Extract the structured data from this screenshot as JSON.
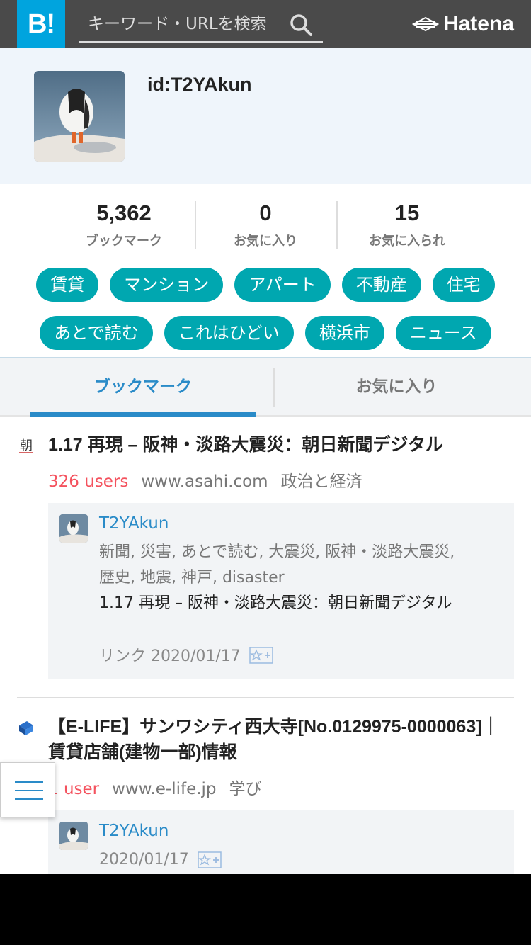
{
  "header": {
    "logo": "B!",
    "search_placeholder": "キーワード・URLを検索",
    "brand": "Hatena"
  },
  "profile": {
    "id": "id:T2YAkun"
  },
  "stats": [
    {
      "num": "5,362",
      "label": "ブックマーク"
    },
    {
      "num": "0",
      "label": "お気に入り"
    },
    {
      "num": "15",
      "label": "お気に入られ"
    }
  ],
  "tags_row1": [
    "賃貸",
    "マンション",
    "アパート",
    "不動産",
    "住宅"
  ],
  "tags_row2": [
    "あとで読む",
    "これはひどい",
    "横浜市",
    "ニュース"
  ],
  "tabs": {
    "bookmarks": "ブックマーク",
    "favorites": "お気に入り"
  },
  "entries": [
    {
      "title": "1.17 再現 – 阪神・淡路大震災：朝日新聞デジタル",
      "users": "326 users",
      "domain": "www.asahi.com",
      "category": "政治と経済",
      "user": "T2YAkun",
      "tags": "新聞, 災害, あとで読む, 大震災, 阪神・淡路大震災, 歴史, 地震, 神戸, disaster",
      "comment": "1.17 再現 – 阪神・淡路大震災：朝日新聞デジタル",
      "date": "リンク 2020/01/17"
    },
    {
      "title": "【E-LIFE】サンワシティ西大寺[No.0129975-0000063]｜賃貸店舗(建物一部)情報",
      "users": "1 user",
      "domain": "www.e-life.jp",
      "category": "学び",
      "user": "T2YAkun",
      "date": "2020/01/17"
    }
  ],
  "colors": {
    "header_bg": "#4a4a4a",
    "logo_bg": "#00a4de",
    "tag_bg": "#00a7b0",
    "accent": "#2a8bc8",
    "users_red": "#f4525e"
  }
}
